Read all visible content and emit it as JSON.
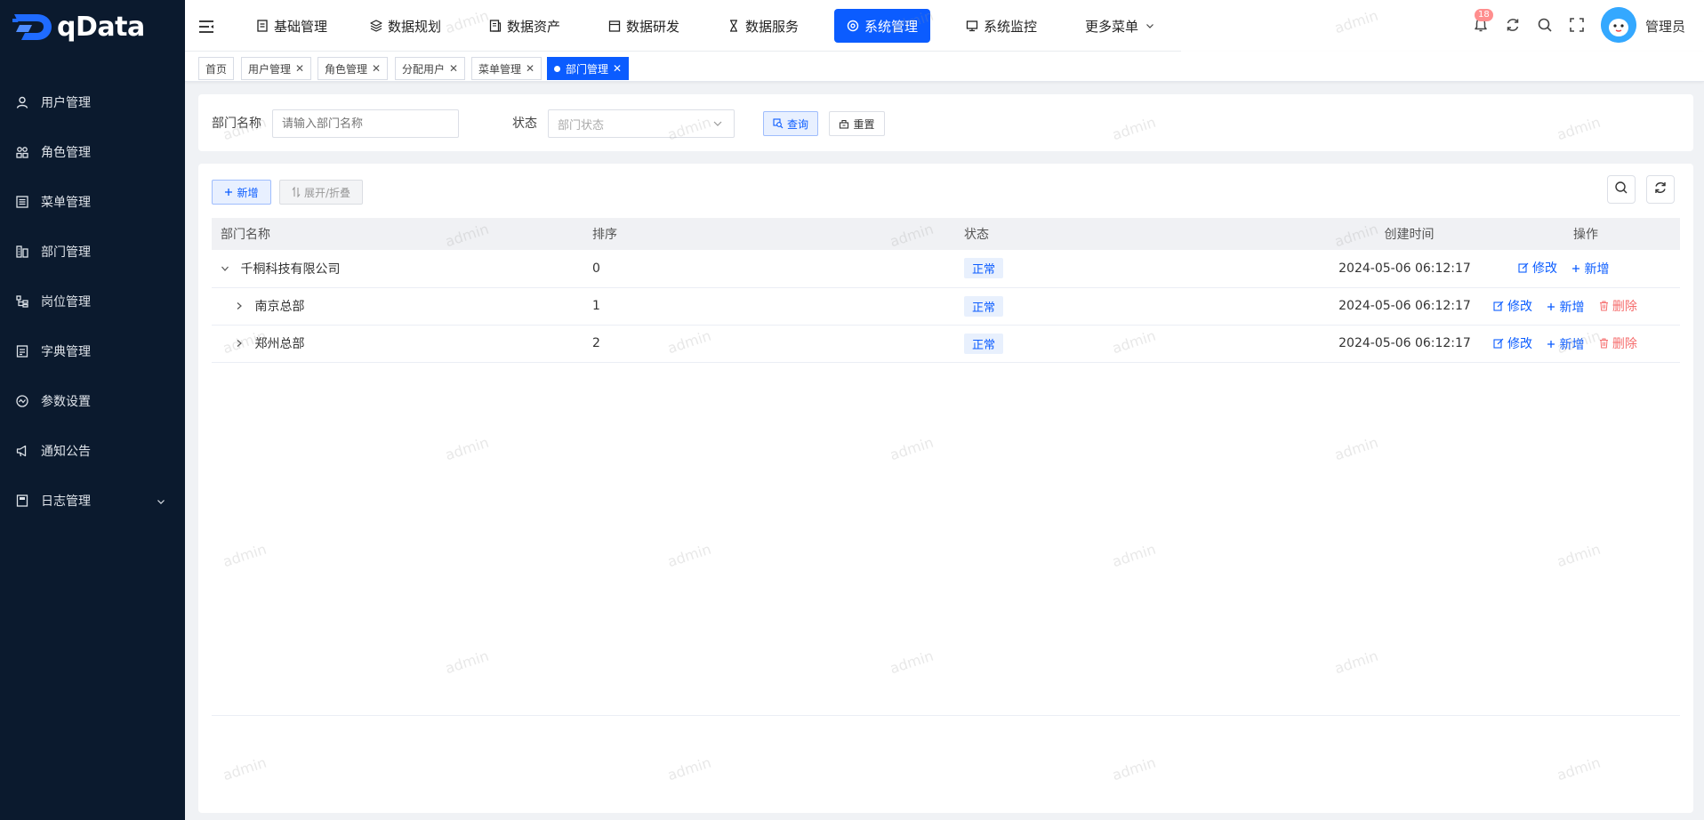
{
  "app": {
    "logo_text": "qData"
  },
  "sidebar": {
    "items": [
      {
        "label": "用户管理",
        "icon": "user-icon"
      },
      {
        "label": "角色管理",
        "icon": "role-icon"
      },
      {
        "label": "菜单管理",
        "icon": "menu-list-icon"
      },
      {
        "label": "部门管理",
        "icon": "department-icon"
      },
      {
        "label": "岗位管理",
        "icon": "post-icon"
      },
      {
        "label": "字典管理",
        "icon": "dictionary-icon"
      },
      {
        "label": "参数设置",
        "icon": "settings-icon"
      },
      {
        "label": "通知公告",
        "icon": "megaphone-icon"
      },
      {
        "label": "日志管理",
        "icon": "log-icon"
      }
    ]
  },
  "topnav": {
    "items": [
      {
        "label": "基础管理"
      },
      {
        "label": "数据规划"
      },
      {
        "label": "数据资产"
      },
      {
        "label": "数据研发"
      },
      {
        "label": "数据服务"
      },
      {
        "label": "系统管理",
        "active": true
      },
      {
        "label": "系统监控"
      },
      {
        "label": "更多菜单"
      }
    ],
    "notification_count": "18",
    "user_name": "管理员"
  },
  "tabs": [
    {
      "label": "首页"
    },
    {
      "label": "用户管理"
    },
    {
      "label": "角色管理"
    },
    {
      "label": "分配用户"
    },
    {
      "label": "菜单管理"
    },
    {
      "label": "部门管理",
      "active": true
    }
  ],
  "search": {
    "dept_name_label": "部门名称",
    "dept_name_placeholder": "请输入部门名称",
    "status_label": "状态",
    "status_placeholder": "部门状态",
    "query_label": "查询",
    "reset_label": "重置"
  },
  "toolbar": {
    "add_label": "新增",
    "expand_label": "展开/折叠"
  },
  "table": {
    "headers": [
      "部门名称",
      "排序",
      "状态",
      "创建时间",
      "操作"
    ],
    "rows": [
      {
        "name": "千桐科技有限公司",
        "order": "0",
        "status": "正常",
        "created": "2024-05-06 06:12:17",
        "expanded": true,
        "level": 0,
        "ops": [
          "修改",
          "新增"
        ]
      },
      {
        "name": "南京总部",
        "order": "1",
        "status": "正常",
        "created": "2024-05-06 06:12:17",
        "expanded": false,
        "level": 1,
        "ops": [
          "修改",
          "新增",
          "删除"
        ]
      },
      {
        "name": "郑州总部",
        "order": "2",
        "status": "正常",
        "created": "2024-05-06 06:12:17",
        "expanded": false,
        "level": 1,
        "ops": [
          "修改",
          "新增",
          "删除"
        ]
      }
    ]
  },
  "watermark_text": "admin",
  "colors": {
    "primary": "#0b5cff",
    "sidebar_bg": "#0b1a2e",
    "danger": "#f56c6c"
  }
}
